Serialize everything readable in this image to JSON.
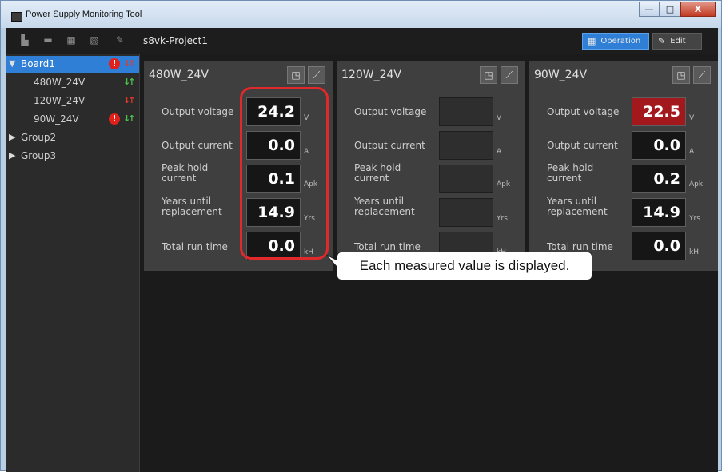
{
  "window": {
    "title": "Power Supply Monitoring Tool",
    "minimize_label": "—",
    "maximize_label": "□",
    "close_label": "X"
  },
  "toolbar": {
    "project_name": "s8vk-Project1",
    "operation_label": "Operation",
    "edit_label": "Edit",
    "icons": [
      "new-icon",
      "open-icon",
      "save-icon",
      "export-icon",
      "settings-icon"
    ]
  },
  "tree": [
    {
      "label": "Board1",
      "selected": true,
      "alarm": true,
      "arrows": "red"
    },
    {
      "label": "480W_24V",
      "alarm": false,
      "arrows": "green"
    },
    {
      "label": "120W_24V",
      "alarm": false,
      "arrows": "red"
    },
    {
      "label": "90W_24V",
      "alarm": true,
      "arrows": "green"
    },
    {
      "label": "Group2"
    },
    {
      "label": "Group3"
    }
  ],
  "rows": {
    "output_voltage": "Output voltage",
    "output_current": "Output current",
    "peak_hold": "Peak hold current",
    "years_until": "Years until replacement",
    "total_run_time": "Total run time"
  },
  "units": {
    "voltage": "V",
    "current": "A",
    "peak": "Apk",
    "years": "Yrs",
    "runtime": "kH"
  },
  "panels": [
    {
      "title": "480W_24V",
      "values": {
        "output_voltage": "24.2",
        "output_current": "0.0",
        "peak_hold": "0.1",
        "years_until": "14.9",
        "total_run_time": "0.0"
      }
    },
    {
      "title": "120W_24V",
      "values": {
        "output_voltage": "",
        "output_current": "",
        "peak_hold": "",
        "years_until": "",
        "total_run_time": ""
      }
    },
    {
      "title": "90W_24V",
      "values": {
        "output_voltage": "22.5",
        "output_current": "0.0",
        "peak_hold": "0.2",
        "years_until": "14.9",
        "total_run_time": "0.0"
      },
      "voltage_alert": true
    }
  ],
  "callout": "Each measured value is displayed.",
  "colors": {
    "accent": "#2f7fd6",
    "alert": "#a2181c",
    "highlight": "#e0292a"
  }
}
